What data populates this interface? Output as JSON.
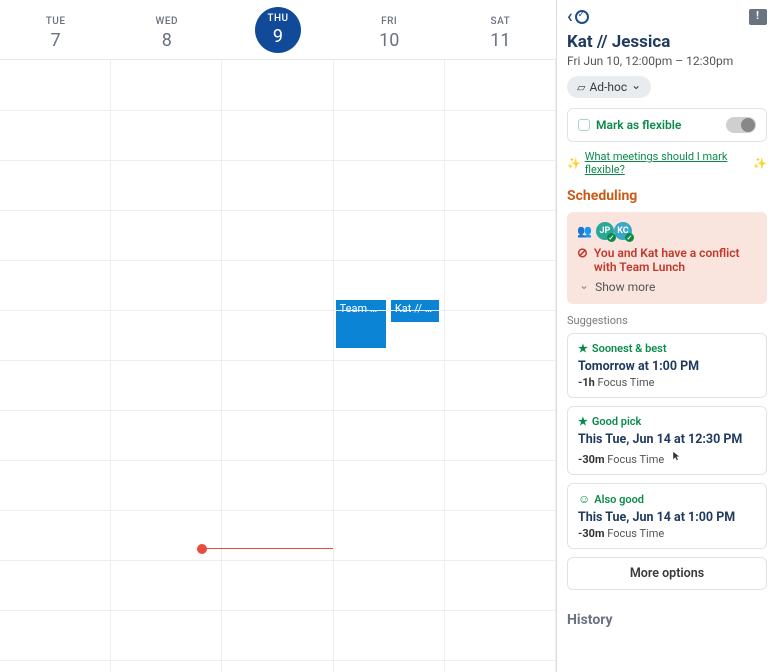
{
  "calendar": {
    "days": [
      {
        "dow": "TUE",
        "num": "7"
      },
      {
        "dow": "WED",
        "num": "8"
      },
      {
        "dow": "THU",
        "num": "9",
        "today": true
      },
      {
        "dow": "FRI",
        "num": "10"
      },
      {
        "dow": "SAT",
        "num": "11"
      }
    ],
    "events": [
      {
        "label": "Team L…",
        "col": 3,
        "left_half": true
      },
      {
        "label": "Kat // …",
        "col": 3,
        "left_half": false
      }
    ]
  },
  "sidebar": {
    "title": "Kat // Jessica",
    "subtitle": "Fri Jun 10, 12:00pm – 12:30pm",
    "tag_label": "Ad-hoc",
    "flex_label": "Mark as flexible",
    "flex_link_text": "What meetings should I mark flexible?",
    "scheduling_header": "Scheduling",
    "avatars": [
      {
        "initials": "JP",
        "bg": "#2aa89a"
      },
      {
        "initials": "KC",
        "bg": "#3aa7c8"
      }
    ],
    "conflict_message": "You and Kat have a conflict with Team Lunch",
    "show_more": "Show more",
    "suggestions_label": "Suggestions",
    "suggestions": [
      {
        "badge": "Soonest & best",
        "icon": "star",
        "time": "Tomorrow at 1:00 PM",
        "impact_amount": "-1h",
        "impact_label": "Focus Time"
      },
      {
        "badge": "Good pick",
        "icon": "star",
        "time": "This Tue, Jun 14 at 12:30 PM",
        "impact_amount": "-30m",
        "impact_label": "Focus Time",
        "cursor": true
      },
      {
        "badge": "Also good",
        "icon": "smile",
        "time": "This Tue, Jun 14 at 1:00 PM",
        "impact_amount": "-30m",
        "impact_label": "Focus Time"
      }
    ],
    "more_options": "More options",
    "history_header": "History"
  }
}
